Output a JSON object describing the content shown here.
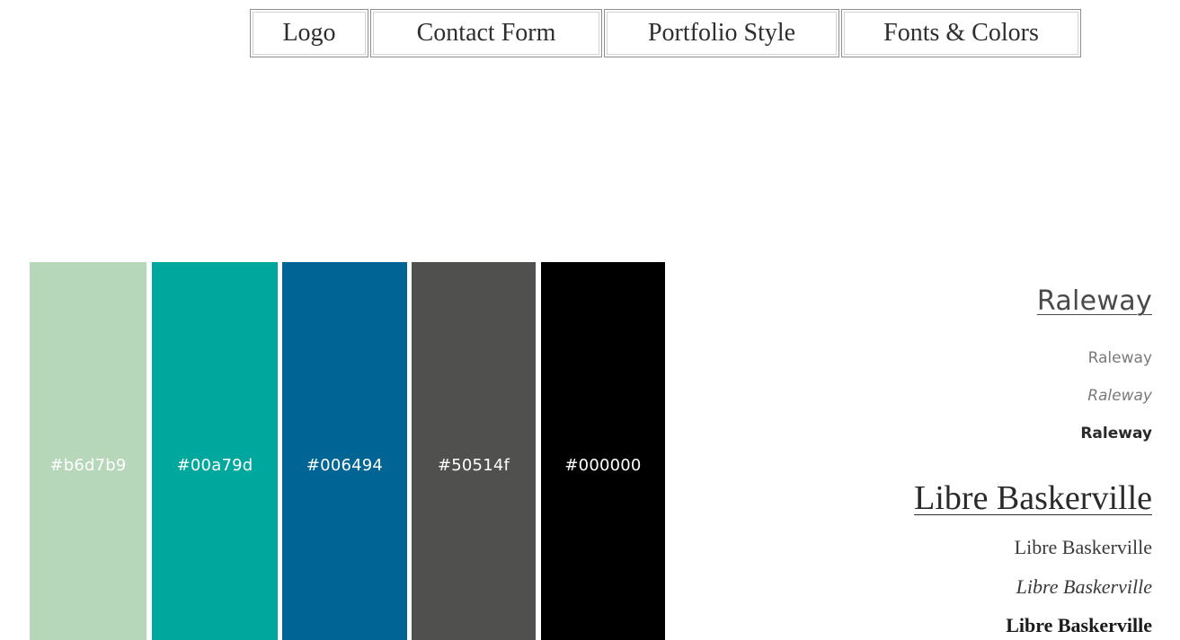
{
  "tabs": [
    {
      "label": "Logo"
    },
    {
      "label": "Contact Form"
    },
    {
      "label": "Portfolio Style"
    },
    {
      "label": "Fonts & Colors"
    }
  ],
  "swatches": [
    {
      "hex": "#b6d7b9",
      "color": "#b6d7b9"
    },
    {
      "hex": "#00a79d",
      "color": "#00a79d"
    },
    {
      "hex": "#006494",
      "color": "#006494"
    },
    {
      "hex": "#50514f",
      "color": "#50514f"
    },
    {
      "hex": "#000000",
      "color": "#000000"
    }
  ],
  "fonts": {
    "raleway": {
      "heading": "Raleway",
      "regular": "Raleway",
      "italic": "Raleway",
      "bold": "Raleway"
    },
    "libre_baskerville": {
      "heading": "Libre Baskerville",
      "regular": "Libre Baskerville",
      "italic": "Libre Baskerville",
      "bold": "Libre Baskerville"
    }
  }
}
